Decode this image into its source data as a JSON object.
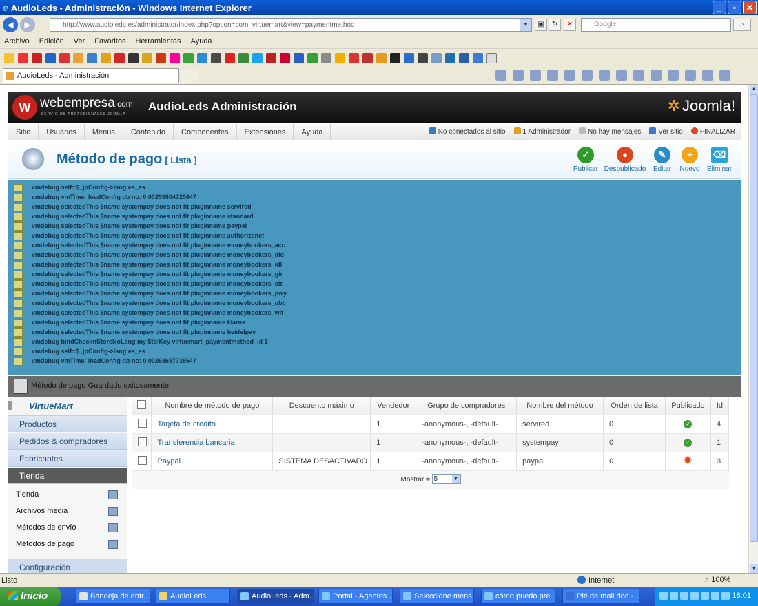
{
  "window": {
    "title": "AudioLeds - Administración - Windows Internet Explorer",
    "ie_icon": "ie-icon"
  },
  "address": {
    "url": "http://www.audioleds.es/administrator/index.php?option=com_virtuemart&view=paymentmethod",
    "search_placeholder": "Google"
  },
  "menubar": [
    "Archivo",
    "Edición",
    "Ver",
    "Favoritos",
    "Herramientas",
    "Ayuda"
  ],
  "tab": {
    "label": "AudioLeds - Administración"
  },
  "joomla": {
    "brand": "webempresa",
    "brand_suffix": ".com",
    "brand_sub": "SERVICIOS PROFESIONALES JOOMLA",
    "admin_title": "AudioLeds Administración",
    "joomla_logo": "Joomla!",
    "nav": [
      "Sitio",
      "Usuarios",
      "Menús",
      "Contenido",
      "Componentes",
      "Extensiones",
      "Ayuda"
    ],
    "status": {
      "not_connected": "No conectados al sitio",
      "admins": "1 Administrador",
      "messages": "No hay mensajes",
      "view_site": "Ver sitio",
      "logout": "FINALIZAR"
    }
  },
  "toolbar": {
    "title": "Método de pago",
    "subtitle": "[ Lista ]",
    "buttons": [
      {
        "label": "Publicar",
        "color": "#2e9a2a",
        "icon": "check-icon"
      },
      {
        "label": "Despublicado",
        "color": "#d9451c",
        "icon": "unpublish-icon"
      },
      {
        "label": "Editar",
        "color": "#2a8bc9",
        "icon": "edit-icon"
      },
      {
        "label": "Nuevo",
        "color": "#f2a416",
        "icon": "plus-icon"
      },
      {
        "label": "Eliminar",
        "color": "#2aa4d5",
        "icon": "trash-icon"
      }
    ]
  },
  "debug_lines": [
    "vmdebug self::$_jpConfig->lang es_es",
    "vmdebug vmTime: loadConfig db no: 0.00259804725647",
    "vmdebug selectedThis $name systempay does not fit pluginname servired",
    "vmdebug selectedThis $name systempay does not fit pluginname standard",
    "vmdebug selectedThis $name systempay does not fit pluginname paypal",
    "vmdebug selectedThis $name systempay does not fit pluginname authorizenet",
    "vmdebug selectedThis $name systempay does not fit pluginname moneybookers_acc",
    "vmdebug selectedThis $name systempay does not fit pluginname moneybookers_did",
    "vmdebug selectedThis $name systempay does not fit pluginname moneybookers_idl",
    "vmdebug selectedThis $name systempay does not fit pluginname moneybookers_gir",
    "vmdebug selectedThis $name systempay does not fit pluginname moneybookers_sft",
    "vmdebug selectedThis $name systempay does not fit pluginname moneybookers_pwy",
    "vmdebug selectedThis $name systempay does not fit pluginname moneybookers_obt",
    "vmdebug selectedThis $name systempay does not fit pluginname moneybookers_wlt",
    "vmdebug selectedThis $name systempay does not fit pluginname klarna",
    "vmdebug selectedThis $name systempay does not fit pluginname heidelpay",
    "vmdebug bindChecknStoreNoLang my $tblKey virtuemart_paymentmethod_id 1",
    "vmdebug self::$_jpConfig->lang es_es",
    "vmdebug vmTime: loadConfig db no: 0.00268697738647"
  ],
  "message": "Método de pago Guardado exitosamente",
  "sidebar": {
    "logo": "VirtueMart",
    "items": [
      "Productos",
      "Pedidos & compradores",
      "Fabricantes",
      "Tienda"
    ],
    "sub_items": [
      "Tienda",
      "Archivos media",
      "Métodos de envío",
      "Métodos de pago"
    ],
    "config": "Configuración"
  },
  "table": {
    "headers": [
      "Nombre de método de pago",
      "Descuento máximo",
      "Vendedor",
      "Grupo de compradores",
      "Nombre del método",
      "Orden de lista",
      "Publicado",
      "Id"
    ],
    "rows": [
      {
        "name": "Tarjeta de crédito",
        "discount": "",
        "vendor": "1",
        "group": "-anonymous-, -default-",
        "method": "servired",
        "order": "0",
        "published": true,
        "id": "4"
      },
      {
        "name": "Transferencia bancaria",
        "discount": "",
        "vendor": "1",
        "group": "-anonymous-, -default-",
        "method": "systempay",
        "order": "0",
        "published": true,
        "id": "1"
      },
      {
        "name": "Paypal",
        "discount": "SISTEMA DESACTIVADO",
        "vendor": "1",
        "group": "-anonymous-, -default-",
        "method": "paypal",
        "order": "0",
        "published": false,
        "id": "3"
      }
    ],
    "pagination_label": "Mostrar #",
    "pagination_value": "5"
  },
  "statusbar": {
    "left": "Listo",
    "zone": "Internet",
    "zoom": "100%"
  },
  "taskbar": {
    "start": "Inicio",
    "tasks": [
      "Bandeja de entr...",
      "AudioLeds",
      "AudioLeds - Adm...",
      "Portal - Agentes ...",
      "Seleccione mens...",
      "cómo puedo pre...",
      "Pié de mail.doc - ..."
    ],
    "clock": "18:01"
  }
}
